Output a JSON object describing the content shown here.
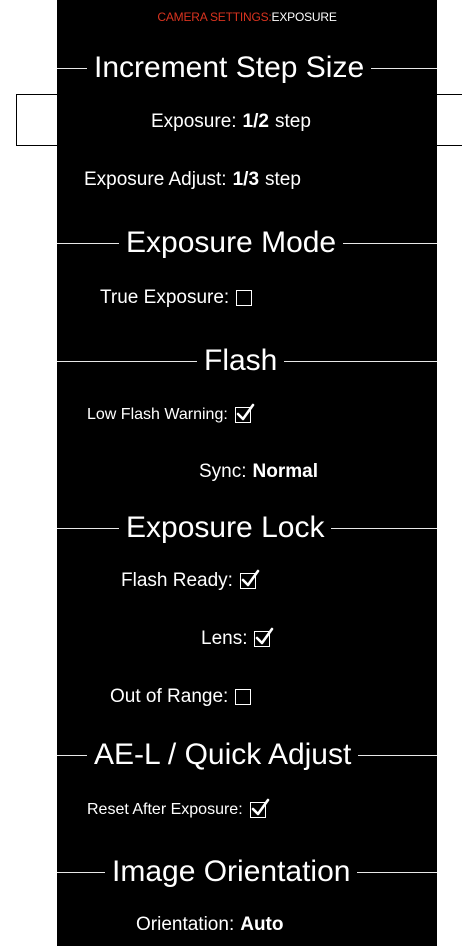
{
  "breadcrumb": {
    "parent": "CAMERA SETTINGS:",
    "current": "EXPOSURE"
  },
  "colors": {
    "accent": "#d8331f",
    "background": "#000000",
    "text": "#ffffff"
  },
  "sections": {
    "increment": "Increment Step Size",
    "exposure_mode": "Exposure Mode",
    "flash": "Flash",
    "exposure_lock": "Exposure Lock",
    "ae_l": "AE-L / Quick Adjust",
    "orientation": "Image Orientation"
  },
  "settings": {
    "exposure": {
      "label": "Exposure:",
      "value": "1/2",
      "unit": "step"
    },
    "exposure_adjust": {
      "label": "Exposure Adjust:",
      "value": "1/3",
      "unit": "step"
    },
    "true_exposure": {
      "label": "True Exposure:",
      "checked": false
    },
    "low_flash_warning": {
      "label": "Low Flash Warning:",
      "checked": true
    },
    "sync": {
      "label": "Sync:",
      "value": "Normal"
    },
    "flash_ready": {
      "label": "Flash Ready:",
      "checked": true
    },
    "lens": {
      "label": "Lens:",
      "checked": true
    },
    "out_of_range": {
      "label": "Out of Range:",
      "checked": false
    },
    "reset_after_exposure": {
      "label": "Reset After Exposure:",
      "checked": true
    },
    "orientation": {
      "label": "Orientation:",
      "value": "Auto"
    }
  }
}
